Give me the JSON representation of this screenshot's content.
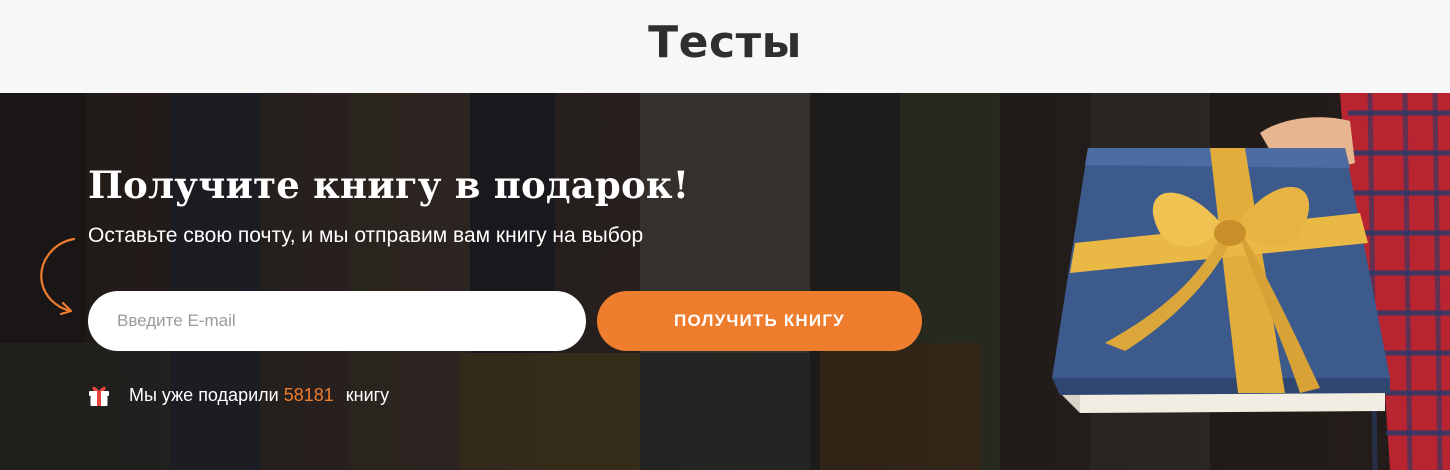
{
  "header": {
    "title": "Тесты"
  },
  "promo": {
    "heading": "Получите книгу в подарок!",
    "subtitle": "Оставьте свою почту, и мы отправим вам книгу на выбор",
    "email_placeholder": "Введите E-mail",
    "email_value": "",
    "button_label": "ПОЛУЧИТЬ КНИГУ",
    "counter_prefix": "Мы уже подарили",
    "counter_value": "58181",
    "counter_suffix": "книгу"
  },
  "icons": {
    "arrow": "curved-arrow-icon",
    "gift": "gift-icon",
    "gift_image": "gift-book-image"
  },
  "colors": {
    "accent": "#ef7d2e",
    "header_bg": "#f7f7f7",
    "title_text": "#2f2f2f",
    "promo_bg": "#1d1a18",
    "gift_book": "#3d5a8c",
    "ribbon": "#e2ad3a"
  }
}
